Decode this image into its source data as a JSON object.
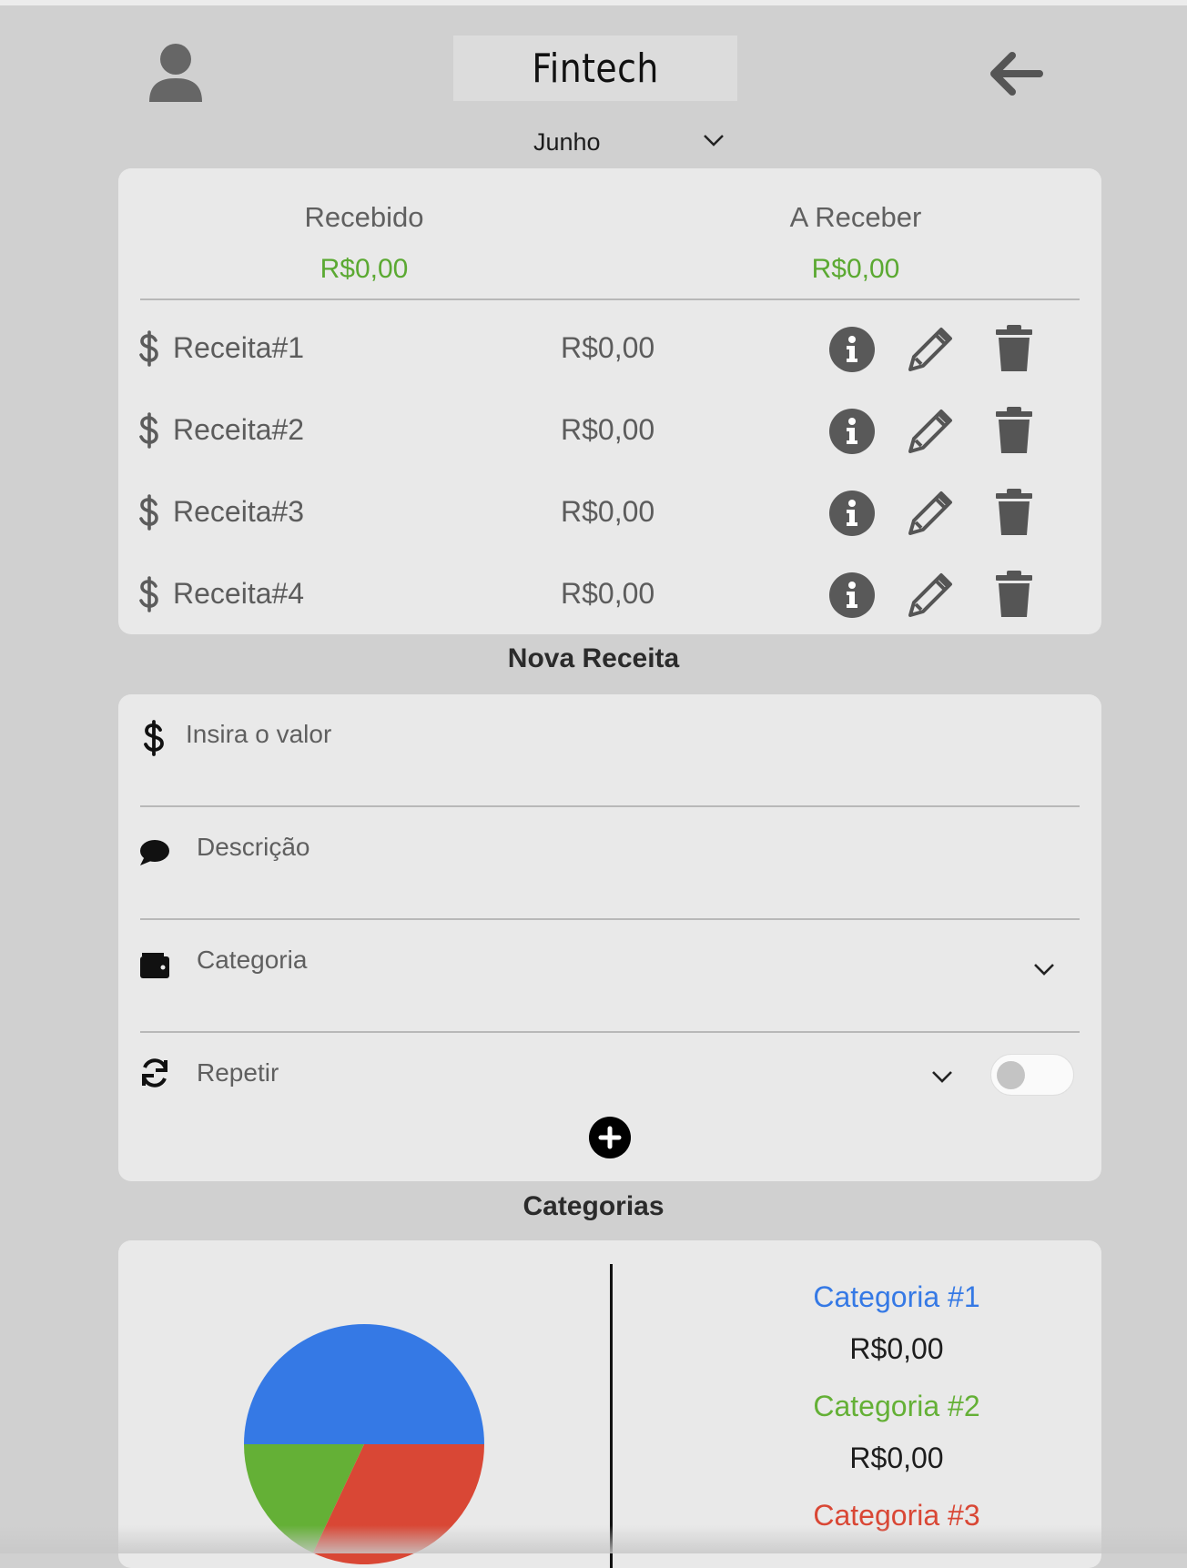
{
  "header": {
    "brand": "Fintech",
    "month_selected": "Junho"
  },
  "summary": {
    "received_label": "Recebido",
    "received_value": "R$0,00",
    "to_receive_label": "A Receber",
    "to_receive_value": "R$0,00",
    "value_color": "#5ba932"
  },
  "incomes": [
    {
      "name": "Receita#1",
      "amount": "R$0,00"
    },
    {
      "name": "Receita#2",
      "amount": "R$0,00"
    },
    {
      "name": "Receita#3",
      "amount": "R$0,00"
    },
    {
      "name": "Receita#4",
      "amount": "R$0,00"
    }
  ],
  "new_income": {
    "title": "Nova Receita",
    "value_placeholder": "Insira o valor",
    "description_placeholder": "Descrição",
    "category_placeholder": "Categoria",
    "repeat_label": "Repetir",
    "repeat_enabled": false
  },
  "categories": {
    "title": "Categorias",
    "items": [
      {
        "name": "Categoria #1",
        "value": "R$0,00",
        "color": "#3579e5"
      },
      {
        "name": "Categoria #2",
        "value": "R$0,00",
        "color": "#64b036"
      },
      {
        "name": "Categoria #3",
        "value": "",
        "color": "#d94735"
      }
    ]
  },
  "chart_data": {
    "type": "pie",
    "slices": [
      {
        "label": "Categoria #1",
        "value": 50,
        "color": "#3579e5"
      },
      {
        "label": "Categoria #3",
        "value": 32,
        "color": "#d94735"
      },
      {
        "label": "Categoria #2",
        "value": 18,
        "color": "#64b036"
      }
    ]
  },
  "icons": {
    "user": "user-icon",
    "back": "arrow-left-icon",
    "dropdown": "chevron-down-icon",
    "dollar": "dollar-icon",
    "info": "info-icon",
    "edit": "pencil-icon",
    "delete": "trash-icon",
    "comment": "comment-icon",
    "wallet": "wallet-icon",
    "repeat": "sync-icon",
    "add": "plus-circle-icon"
  }
}
